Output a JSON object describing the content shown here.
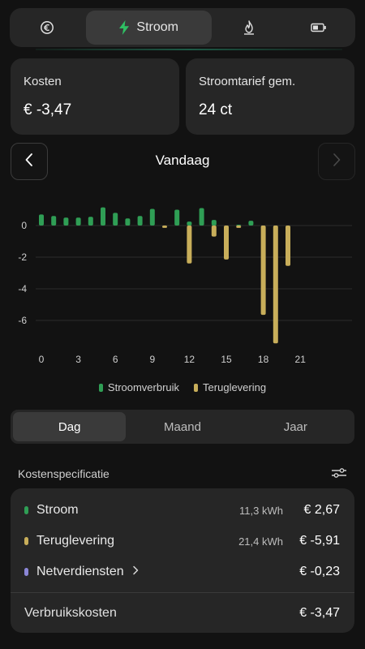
{
  "top_tabs": {
    "items": [
      {
        "icon": "euro-icon"
      },
      {
        "icon": "lightning-icon",
        "label": "Stroom"
      },
      {
        "icon": "flame-icon"
      },
      {
        "icon": "battery-icon"
      }
    ],
    "active": "Stroom"
  },
  "summary": {
    "kosten_label": "Kosten",
    "kosten_value": "€ -3,47",
    "tarief_label": "Stroomtarief gem.",
    "tarief_value": "24 ct"
  },
  "date_nav": {
    "title": "Vandaag"
  },
  "colors": {
    "consumption": "#2f9e55",
    "feed_in": "#c8ae5a",
    "net_fees": "#8b86d6",
    "background": "#121212",
    "card": "#262626"
  },
  "chart_data": {
    "type": "bar",
    "x": [
      0,
      1,
      2,
      3,
      4,
      5,
      6,
      7,
      8,
      9,
      10,
      11,
      12,
      13,
      14,
      15,
      16,
      17,
      18,
      19,
      20
    ],
    "xticks": [
      0,
      3,
      6,
      9,
      12,
      15,
      18,
      21
    ],
    "ylim": [
      -7.6,
      1.6
    ],
    "yticks": [
      0,
      -2,
      -4,
      -6
    ],
    "series": [
      {
        "name": "Stroomverbruik",
        "color": "#2f9e55",
        "values": [
          0.7,
          0.6,
          0.5,
          0.5,
          0.55,
          1.15,
          0.8,
          0.45,
          0.6,
          1.05,
          0,
          1.0,
          0.25,
          1.1,
          0.35,
          0,
          0.05,
          0.3,
          0,
          0,
          0
        ]
      },
      {
        "name": "Teruglevering",
        "color": "#c8ae5a",
        "values": [
          0,
          0,
          0,
          0,
          0,
          0,
          0,
          0,
          0,
          0,
          -0.15,
          0,
          -2.4,
          0,
          -0.7,
          -2.15,
          -0.15,
          0,
          -5.65,
          -7.45,
          -2.55
        ]
      }
    ],
    "legend_position": "bottom"
  },
  "period_tabs": {
    "items": [
      "Dag",
      "Maand",
      "Jaar"
    ],
    "active": "Dag"
  },
  "spec": {
    "title": "Kostenspecificatie",
    "rows": [
      {
        "name": "Stroom",
        "kwh": "11,3 kWh",
        "amount": "€ 2,67"
      },
      {
        "name": "Teruglevering",
        "kwh": "21,4 kWh",
        "amount": "€ -5,91"
      },
      {
        "name": "Netverdiensten",
        "amount": "€ -0,23"
      }
    ],
    "total_label": "Verbruikskosten",
    "total_amount": "€ -3,47"
  }
}
